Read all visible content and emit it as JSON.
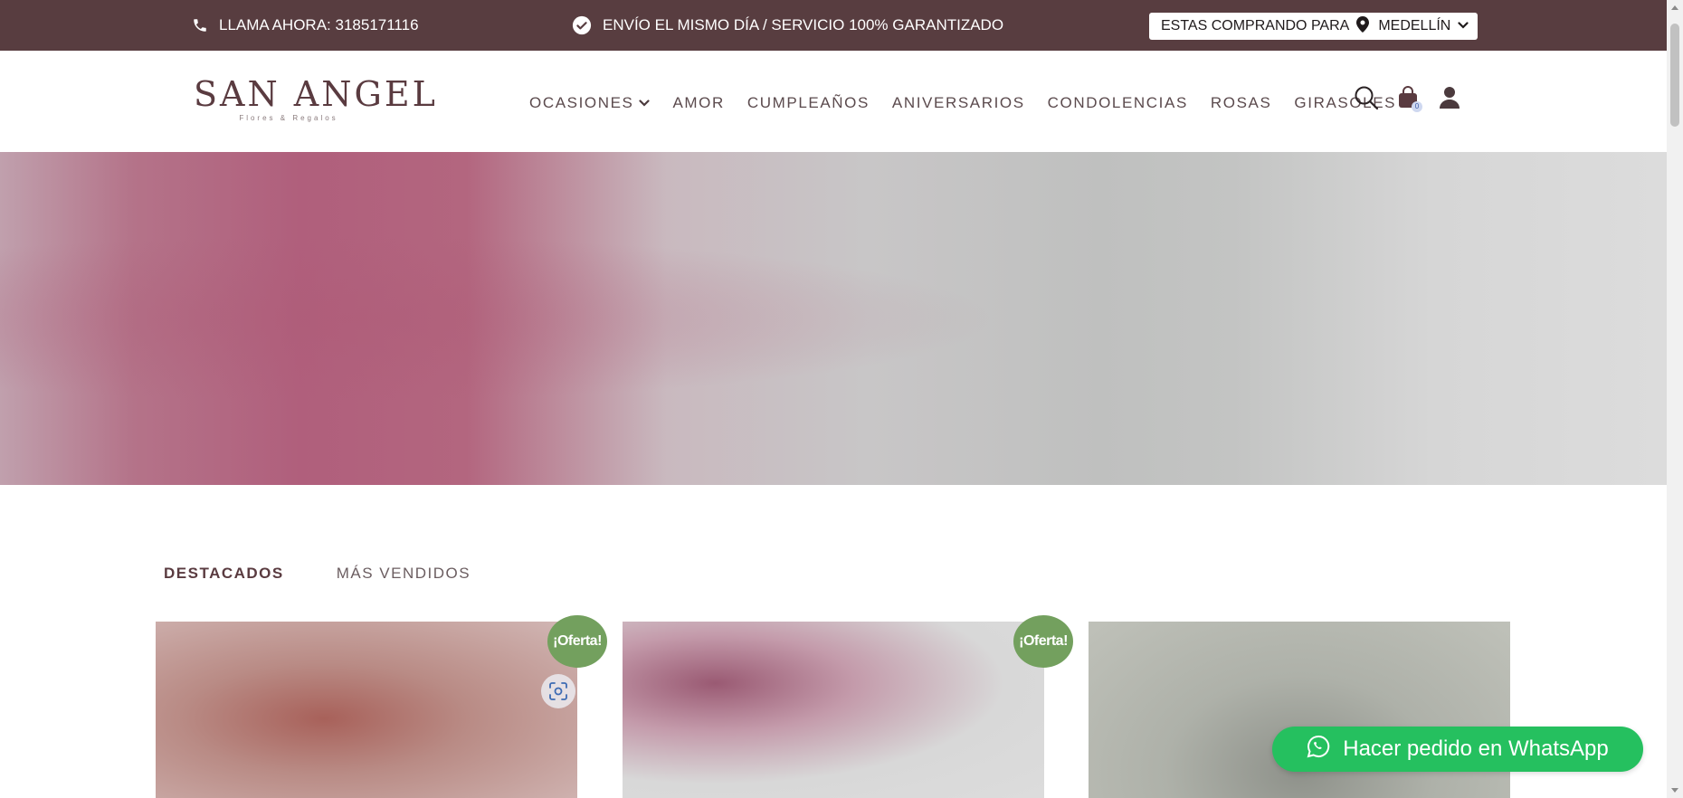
{
  "topbar": {
    "phone_text": "LLAMA AHORA: 3185171116",
    "phone_icon": "phone-icon",
    "shipping_text": "ENVÍO EL MISMO DÍA / SERVICIO 100% GARANTIZADO",
    "shipping_icon": "check-circle-icon",
    "city_prefix": "ESTAS COMPRANDO PARA",
    "city_icon": "map-pin-icon",
    "city": "MEDELLÍN",
    "background_color": "#583d40"
  },
  "logo": {
    "name": "SAN ANGEL",
    "tagline": "Flores & Regalos"
  },
  "nav": {
    "items": [
      {
        "label": "OCASIONES",
        "has_dropdown": true
      },
      {
        "label": "AMOR"
      },
      {
        "label": "CUMPLEAÑOS"
      },
      {
        "label": "ANIVERSARIOS"
      },
      {
        "label": "CONDOLENCIAS"
      },
      {
        "label": "ROSAS"
      },
      {
        "label": "GIRASOLES"
      }
    ],
    "icons": [
      "search-icon",
      "shopping-bag-icon",
      "user-icon"
    ],
    "cart_count": "0"
  },
  "tabs": [
    {
      "label": "DESTACADOS",
      "active": true
    },
    {
      "label": "MÁS VENDIDOS",
      "active": false
    }
  ],
  "products": {
    "badge_label": "¡Oferta!",
    "zoom_icon": "zoom-scan-icon"
  },
  "whatsapp": {
    "label": "Hacer pedido en WhatsApp",
    "icon": "whatsapp-icon",
    "color": "#25c05f"
  },
  "colors": {
    "brand": "#583d40",
    "offer_badge": "#73a05e"
  }
}
